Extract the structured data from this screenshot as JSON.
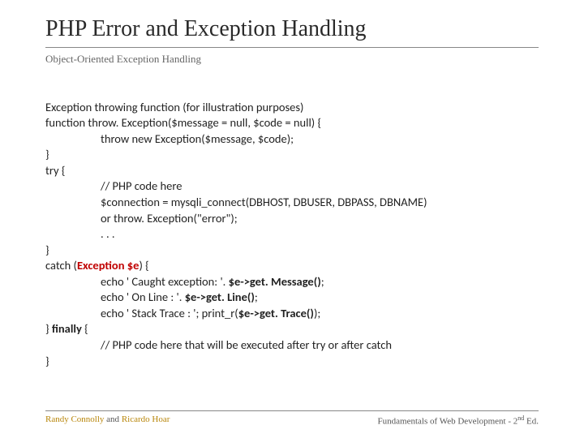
{
  "title": "PHP Error and Exception Handling",
  "subtitle": "Object-Oriented Exception Handling",
  "code": {
    "l1": "Exception throwing function (for illustration purposes)",
    "l2": "function throw. Exception($message = null, $code = null) {",
    "l3": "throw new Exception($message, $code);",
    "l4": "}",
    "l5": "try {",
    "l6": "// PHP code here",
    "l7": "$connection = mysqli_connect(DBHOST, DBUSER, DBPASS, DBNAME)",
    "l8": "or throw. Exception(\"error\");",
    "l9": ". . .",
    "l10": "}",
    "l11a": "catch (",
    "l11b": "Exception $e",
    "l11c": ") {",
    "l12a": "echo ' Caught exception: '. ",
    "l12b": "$e->get. Message()",
    "l12c": ";",
    "l13a": "echo ' On Line : '. ",
    "l13b": "$e->get. Line()",
    "l13c": ";",
    "l14a": "echo ' Stack Trace : '; print_r(",
    "l14b": "$e->get. Trace()",
    "l14c": ");",
    "l15a": "} ",
    "l15b": "finally",
    "l15c": " {",
    "l16": "// PHP code here that will be executed after try or after catch",
    "l17": "}"
  },
  "footer": {
    "author1": "Randy Connolly",
    "and": " and ",
    "author2": "Ricardo Hoar",
    "book_prefix": "Fundamentals of Web Development - 2",
    "book_sup": "nd",
    "book_suffix": " Ed."
  }
}
